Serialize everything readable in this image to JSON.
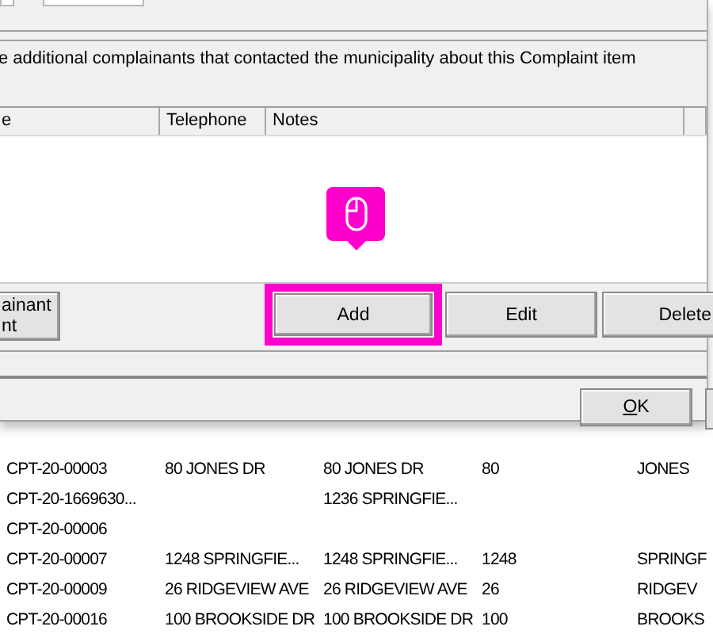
{
  "dialog": {
    "instruction": "e additional complainants that contacted the municipality about this Complaint item",
    "list": {
      "columns": [
        "e",
        "Telephone",
        "Notes"
      ]
    },
    "tooltip": {
      "kind": "mouse-click"
    },
    "buttons": [
      {
        "label": "ainant\nnt",
        "highlighted": false
      },
      {
        "label": "Add",
        "highlighted": true
      },
      {
        "label": "Edit",
        "highlighted": false
      },
      {
        "label": "Delete",
        "highlighted": false
      }
    ],
    "ok_button": "OK"
  },
  "background_table": {
    "rows": [
      [
        "CPT-20-00003",
        "80 JONES DR",
        "80 JONES DR",
        "80",
        "JONES"
      ],
      [
        "CPT-20-1669630...",
        "",
        "1236 SPRINGFIE...",
        "",
        ""
      ],
      [
        "CPT-20-00006",
        "",
        "",
        "",
        ""
      ],
      [
        "CPT-20-00007",
        "1248 SPRINGFIE...",
        "1248 SPRINGFIE...",
        "1248",
        "SPRINGF"
      ],
      [
        "CPT-20-00009",
        "26 RIDGEVIEW AVE",
        "26 RIDGEVIEW AVE",
        "26",
        "RIDGEV"
      ],
      [
        "CPT-20-00016",
        "100 BROOKSIDE DR",
        "100 BROOKSIDE DR",
        "100",
        "BROOKS"
      ]
    ]
  }
}
